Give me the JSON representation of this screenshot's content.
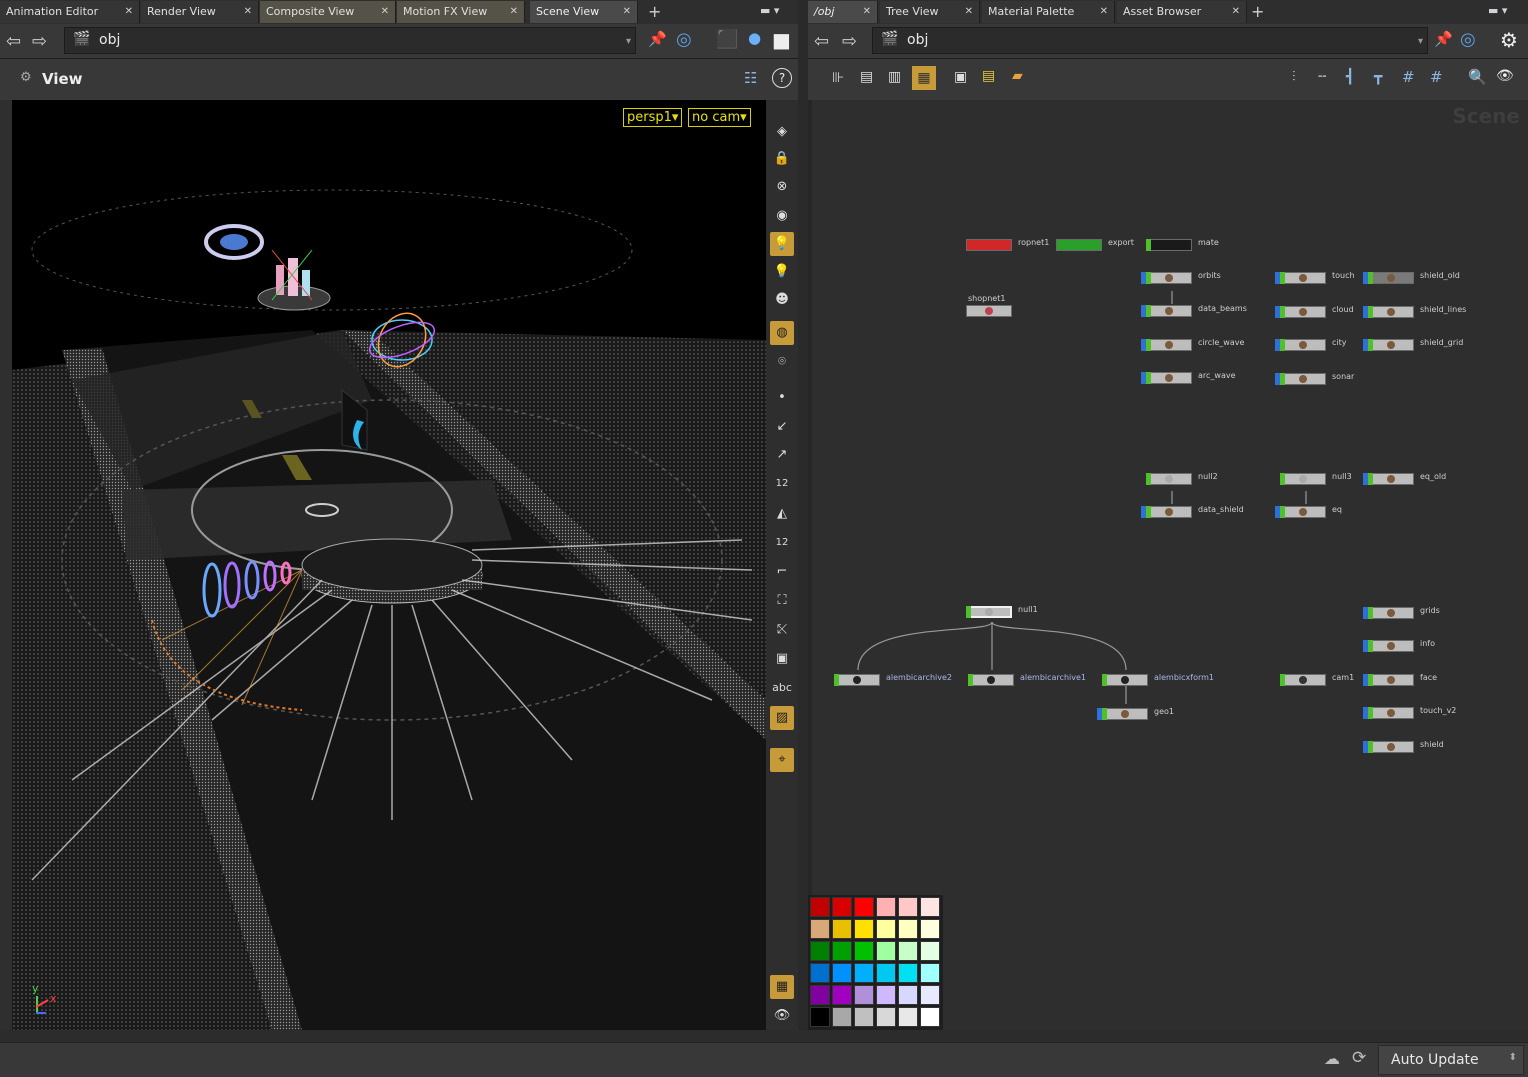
{
  "left_tabs": [
    {
      "label": "Animation Editor"
    },
    {
      "label": "Render View"
    },
    {
      "label": "Composite View"
    },
    {
      "label": "Motion FX View"
    },
    {
      "label": "Scene View"
    }
  ],
  "right_tabs": [
    {
      "label": "/obj"
    },
    {
      "label": "Tree View"
    },
    {
      "label": "Material Palette"
    },
    {
      "label": "Asset Browser"
    }
  ],
  "left_path": "obj",
  "right_path": "obj",
  "view_title": "View",
  "camera_menu": "persp1▾",
  "cam_menu": "no cam▾",
  "viewport_tool_label_num": "12",
  "viewport_tool_label_num2": "12",
  "viewport_tool_text": "abc",
  "network_watermark": "Scene",
  "axis": {
    "y": "y",
    "x": "x"
  },
  "nodes": {
    "ropnet1": "ropnet1",
    "export": "export",
    "mate": "mate",
    "shopnet1": "shopnet1",
    "orbits": "orbits",
    "data_beams": "data_beams",
    "circle_wave": "circle_wave",
    "arc_wave": "arc_wave",
    "touch": "touch",
    "cloud": "cloud",
    "city": "city",
    "sonar": "sonar",
    "shield_old": "shield_old",
    "shield_lines": "shield_lines",
    "shield_grid": "shield_grid",
    "null2": "null2",
    "data_shield": "data_shield",
    "null3": "null3",
    "eq": "eq",
    "eq_old": "eq_old",
    "null1": "null1",
    "alembicarchive2": "alembicarchive2",
    "alembicarchive1": "alembicarchive1",
    "alembicxform1": "alembicxform1",
    "geo1": "geo1",
    "cam1": "cam1",
    "grids": "grids",
    "info": "info",
    "face": "face",
    "touch_v2": "touch_v2",
    "shield": "shield"
  },
  "palette_colors": [
    [
      "#c00000",
      "#d80000",
      "#ff0000",
      "#ffb0b0",
      "#ffc8c8",
      "#ffe4e4"
    ],
    [
      "#d8a878",
      "#e8c000",
      "#ffe000",
      "#ffffa0",
      "#ffffc0",
      "#ffffe0"
    ],
    [
      "#008000",
      "#00a000",
      "#00c000",
      "#a0ffa0",
      "#c8ffc8",
      "#e4ffe4"
    ],
    [
      "#0070d0",
      "#0090ff",
      "#00b0ff",
      "#00c8f0",
      "#00e0f0",
      "#a0ffff"
    ],
    [
      "#8000a0",
      "#a000c0",
      "#b090d8",
      "#d0b8ff",
      "#d8d8ff",
      "#e8e8ff"
    ],
    [
      "#000000",
      "#a8a8a8",
      "#c0c0c0",
      "#d8d8d8",
      "#e8e8e8",
      "#ffffff"
    ]
  ],
  "status": {
    "auto_update": "Auto Update"
  },
  "colors": {
    "accent": "#c79a3a",
    "node_green": "#4fbf2a",
    "node_blue": "#2f6fd8",
    "node_red": "#d02828"
  }
}
